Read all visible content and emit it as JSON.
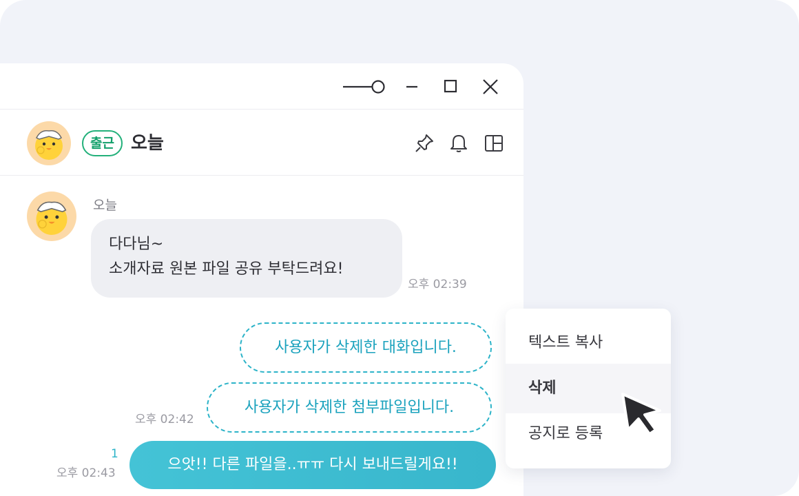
{
  "window": {
    "controls": {
      "pin_slider": "pin-window-slider-icon",
      "minimize": "minimize-icon",
      "maximize": "maximize-icon",
      "close": "close-icon"
    }
  },
  "header": {
    "status_badge": "출근",
    "title": "오늘",
    "icons": [
      "pin-icon",
      "bell-icon",
      "layout-panel-icon"
    ]
  },
  "messages": {
    "incoming": {
      "sender": "오늘",
      "line1": "다다님~",
      "line2": "소개자료 원본 파일 공유 부탁드려요!",
      "time": "오후 02:39"
    },
    "deleted_1": {
      "text": "사용자가 삭제한 대화입니다."
    },
    "deleted_2": {
      "text": "사용자가 삭제한 첨부파일입니다.",
      "time": "오후 02:42"
    },
    "outgoing": {
      "text": "으앗!! 다른 파일을..ㅠㅠ 다시 보내드릴게요!!",
      "unread_count": "1",
      "time": "오후 02:43"
    }
  },
  "context_menu": {
    "items": [
      {
        "label": "텍스트 복사"
      },
      {
        "label": "삭제",
        "state": "hover"
      },
      {
        "label": "공지로 등록"
      }
    ]
  },
  "colors": {
    "accent": "#38b6cc",
    "badge_green": "#22b07a",
    "avatar_bg": "#fcd9a8",
    "backdrop": "#f1f3f9"
  }
}
